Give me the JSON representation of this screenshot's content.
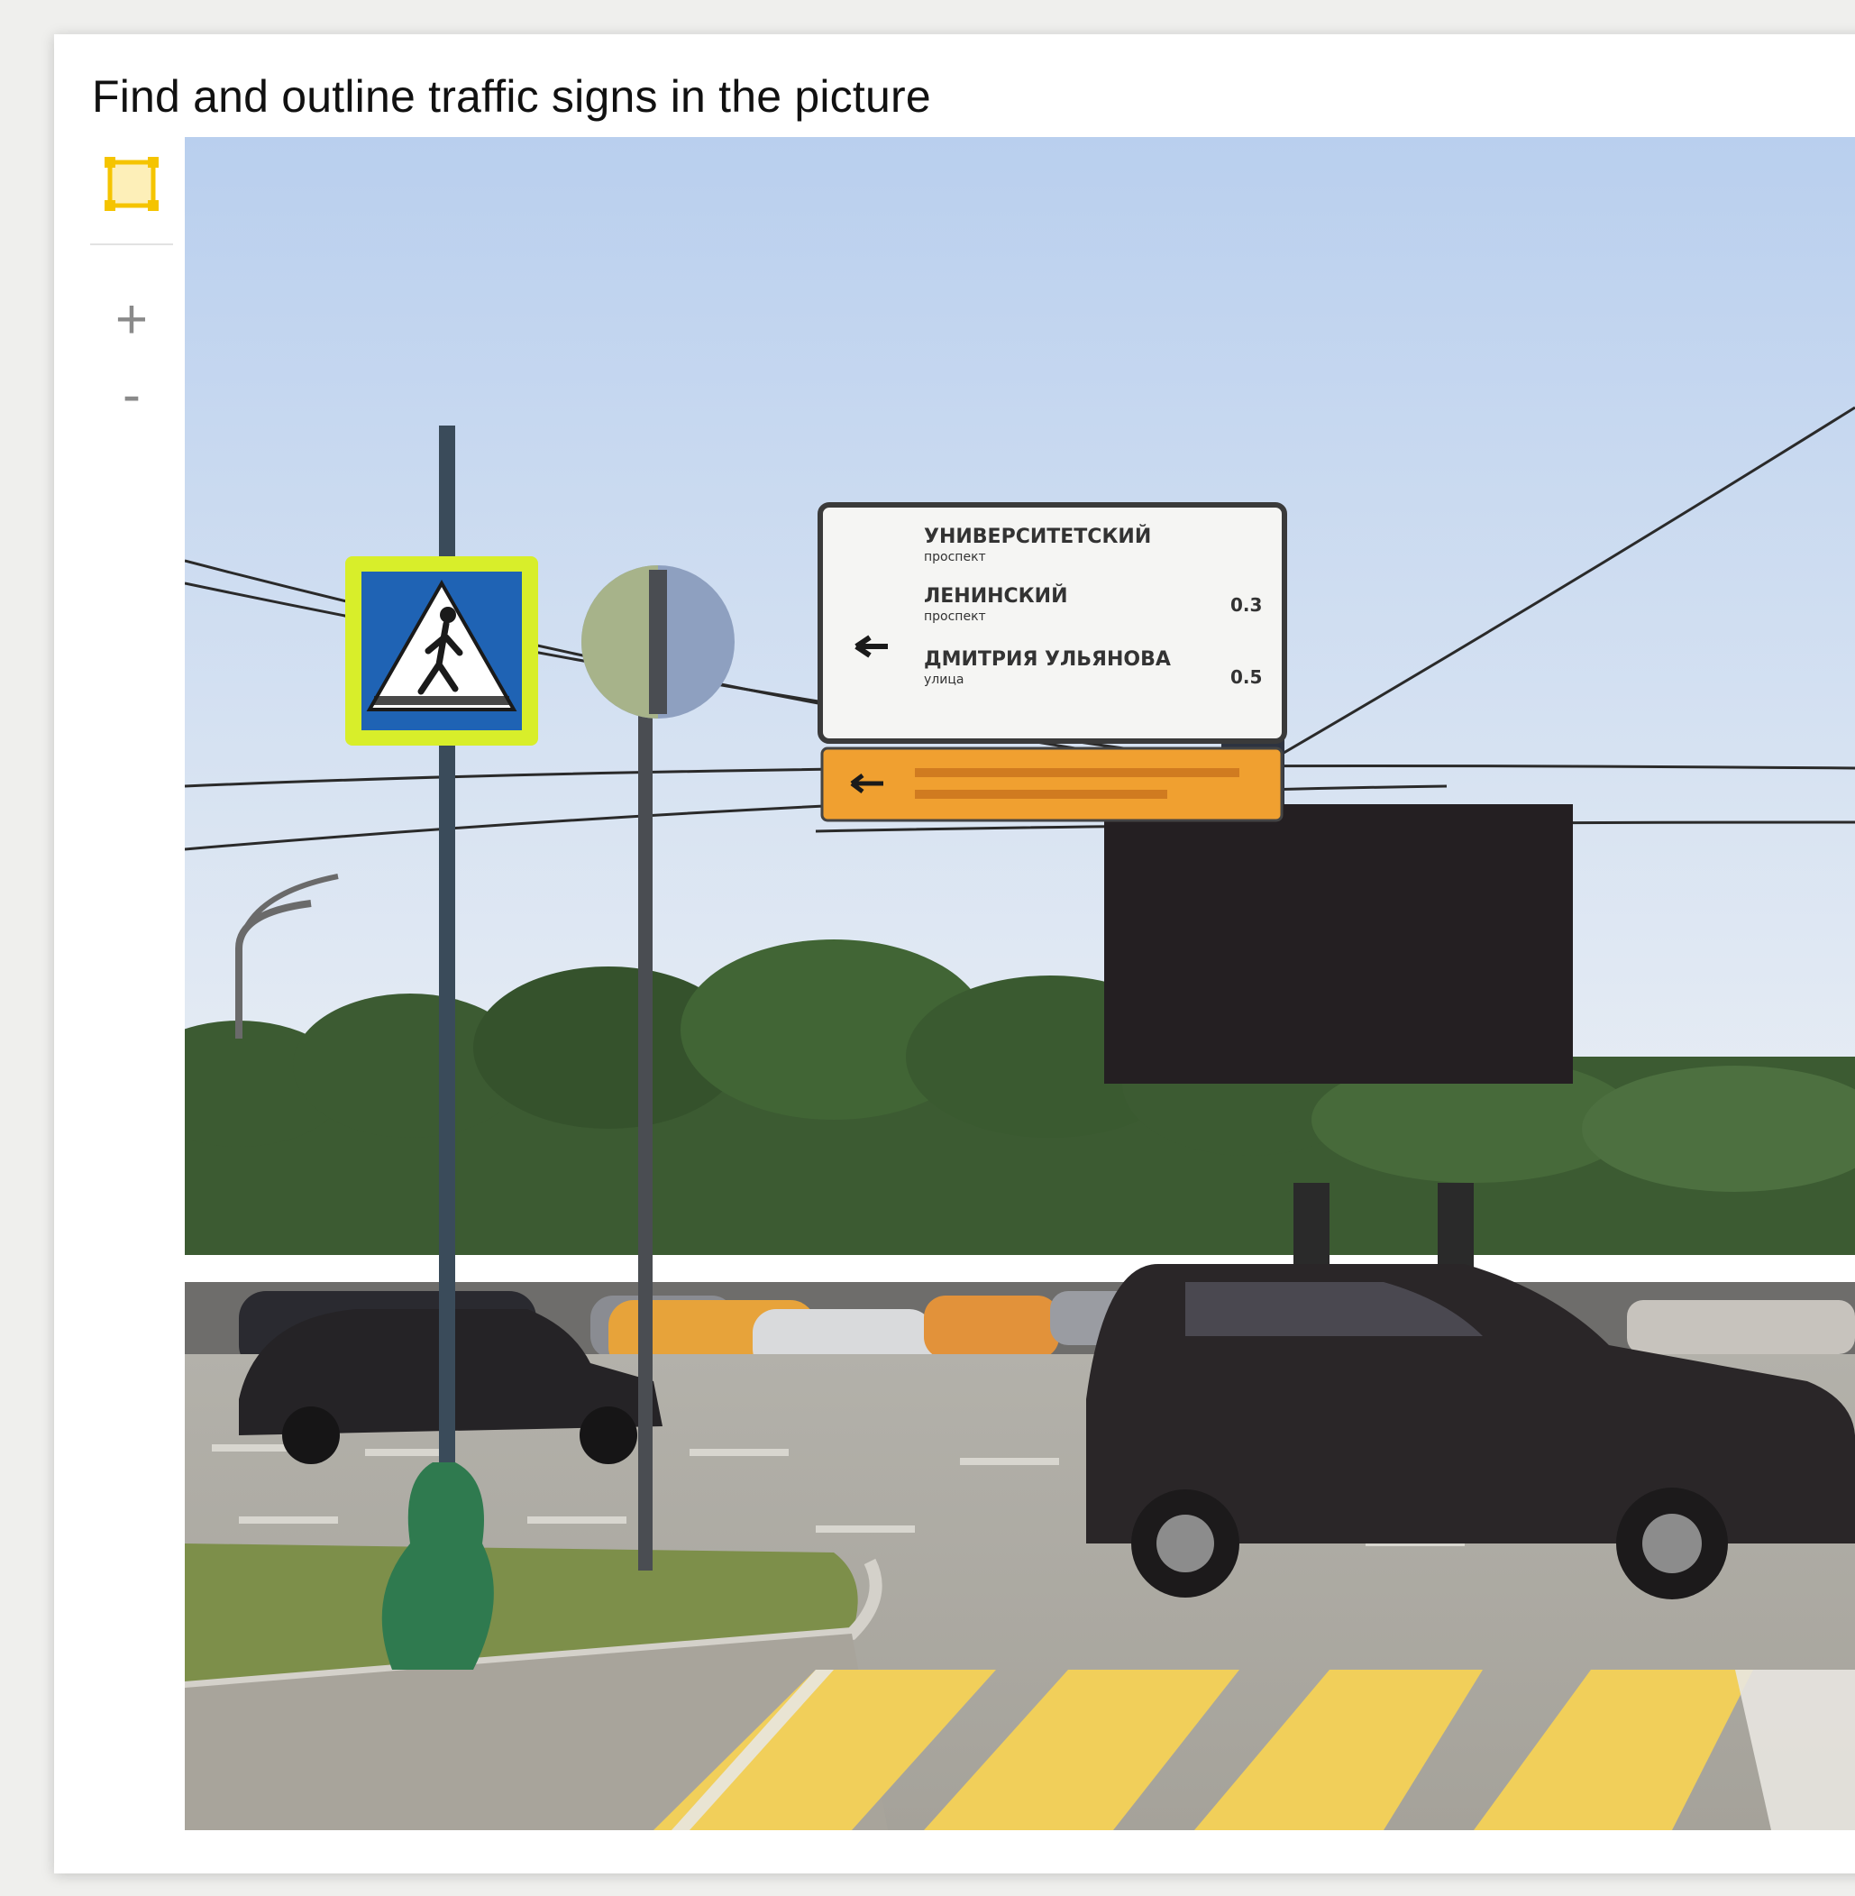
{
  "task": {
    "prompt": "Find and outline traffic signs in the picture"
  },
  "toolbar": {
    "tools": [
      {
        "icon": "rectangle-tool-icon",
        "active": true
      }
    ],
    "zoom_in_label": "+",
    "zoom_out_label": "-"
  },
  "colors": {
    "tool_accent": "#f5c400",
    "tool_fill": "#fdefb8",
    "sign_yellow_green": "#d8ee2a",
    "sign_blue": "#1f63b4",
    "sign_orange": "#f0a030"
  },
  "image": {
    "subject": "street-scene-with-traffic-signs",
    "direction_sign": {
      "rows": [
        {
          "name": "УНИВЕРСИТЕТСКИЙ",
          "type": "проспект",
          "distance": ""
        },
        {
          "name": "ЛЕНИНСКИЙ",
          "type": "проспект",
          "distance": "0.3"
        },
        {
          "name": "ДМИТРИЯ УЛЬЯНОВА",
          "type": "улица",
          "distance": "0.5"
        }
      ]
    }
  }
}
